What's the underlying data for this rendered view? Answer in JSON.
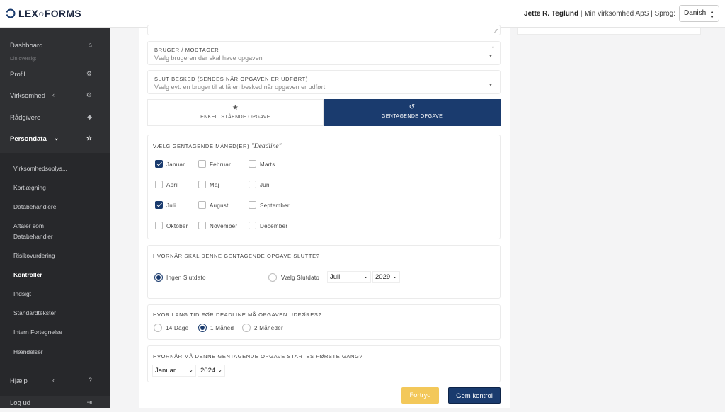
{
  "header": {
    "logo_text": "LEX○FORMS",
    "user_name": "Jette R. Teglund",
    "company": "Min virksomhed ApS",
    "lang_label": "Sprog:",
    "lang_value": "Danish"
  },
  "sidebar": {
    "items": [
      {
        "label": "Dashboard",
        "icon": "home-icon"
      },
      {
        "label": "Din oversigt"
      },
      {
        "label": "Profil",
        "icon": "gear-icon"
      },
      {
        "label": "Virksomhed",
        "icon": "gear-icon"
      },
      {
        "label": "Rådgivere",
        "icon": "graduation-cap-icon"
      },
      {
        "label": "Persondata",
        "icon": "star-icon"
      }
    ],
    "sub_items": [
      "Virksomhedsoplys...",
      "Kortlægning",
      "Databehandlere",
      "Aftaler som Databehandler",
      "Risikovurdering",
      "Kontroller",
      "Indsigt",
      "Standardtekster",
      "Intern Fortegnelse",
      "Hændelser"
    ],
    "help_label": "Hjælp",
    "logout_label": "Log ud"
  },
  "form": {
    "recipient_label": "BRUGER / MODTAGER",
    "recipient_placeholder": "Vælg brugeren der skal have opgaven",
    "required_mark": "*",
    "end_msg_label": "SLUT BESKED (SENDES NÅR OPGAVEN ER UDFØRT)",
    "end_msg_placeholder": "Vælg evt. en bruger til at få en besked når opgaven er udført",
    "tab_single": "ENKELTSTÅENDE OPGAVE",
    "tab_recurring": "GENTAGENDE OPGAVE",
    "months_label": "VÆLG GENTAGENDE MÅNED(ER)",
    "months_deadline": "\"Deadline\"",
    "months": [
      {
        "label": "Januar",
        "checked": true
      },
      {
        "label": "Februar",
        "checked": false
      },
      {
        "label": "Marts",
        "checked": false
      },
      {
        "label": "April",
        "checked": false
      },
      {
        "label": "Maj",
        "checked": false
      },
      {
        "label": "Juni",
        "checked": false
      },
      {
        "label": "Juli",
        "checked": true
      },
      {
        "label": "August",
        "checked": false
      },
      {
        "label": "September",
        "checked": false
      },
      {
        "label": "Oktober",
        "checked": false
      },
      {
        "label": "November",
        "checked": false
      },
      {
        "label": "December",
        "checked": false
      }
    ],
    "end_label": "HVORNÅR SKAL DENNE GENTAGENDE OPGAVE SLUTTE?",
    "end_none": "Ingen Slutdato",
    "end_pick": "Vælg Slutdato",
    "end_month": "Juli",
    "end_year": "2029",
    "lead_label": "HVOR LANG TID FØR DEADLINE MÅ OPGAVEN UDFØRES?",
    "lead_options": [
      "14 Dage",
      "1 Måned",
      "2 Måneder"
    ],
    "lead_selected": "1 Måned",
    "start_label": "HVORNÅR MÅ DENNE GENTAGENDE OPGAVE STARTES FØRSTE GANG?",
    "start_month": "Januar",
    "start_year": "2024",
    "cancel_label": "Fortryd",
    "save_label": "Gem kontrol"
  },
  "colors": {
    "primary": "#1a3b6e",
    "cancel": "#f3c85a",
    "sidebar": "#2f3033"
  }
}
